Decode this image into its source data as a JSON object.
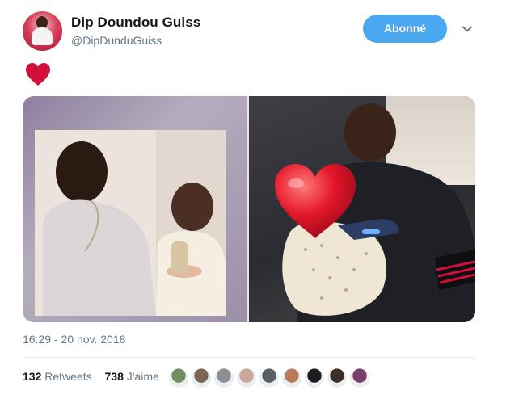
{
  "tweet": {
    "display_name": "Dip Doundou Guiss",
    "handle": "@DipDunduGuiss",
    "follow_label": "Abonné",
    "body_emoji": "heart-emoji",
    "timestamp": "16:29 - 20 nov. 2018"
  },
  "stats": {
    "retweets_count": "132",
    "retweets_label": "Retweets",
    "likes_count": "738",
    "likes_label": "J'aime"
  },
  "likers": [
    {
      "icon": "liker-avatar",
      "color": "#6f8f5e"
    },
    {
      "icon": "liker-avatar",
      "color": "#7a6556"
    },
    {
      "icon": "liker-avatar",
      "color": "#8b8f93"
    },
    {
      "icon": "liker-avatar",
      "color": "#c9a79a"
    },
    {
      "icon": "liker-avatar",
      "color": "#5a5f63"
    },
    {
      "icon": "liker-avatar",
      "color": "#b97a5a"
    },
    {
      "icon": "liker-avatar",
      "color": "#1d1d1f"
    },
    {
      "icon": "liker-avatar",
      "color": "#3b2f2a"
    },
    {
      "icon": "liker-avatar",
      "color": "#7b3f6e"
    }
  ],
  "colors": {
    "accent": "#4aa8f0",
    "heart": "#d0103a",
    "muted_text": "#657786"
  }
}
